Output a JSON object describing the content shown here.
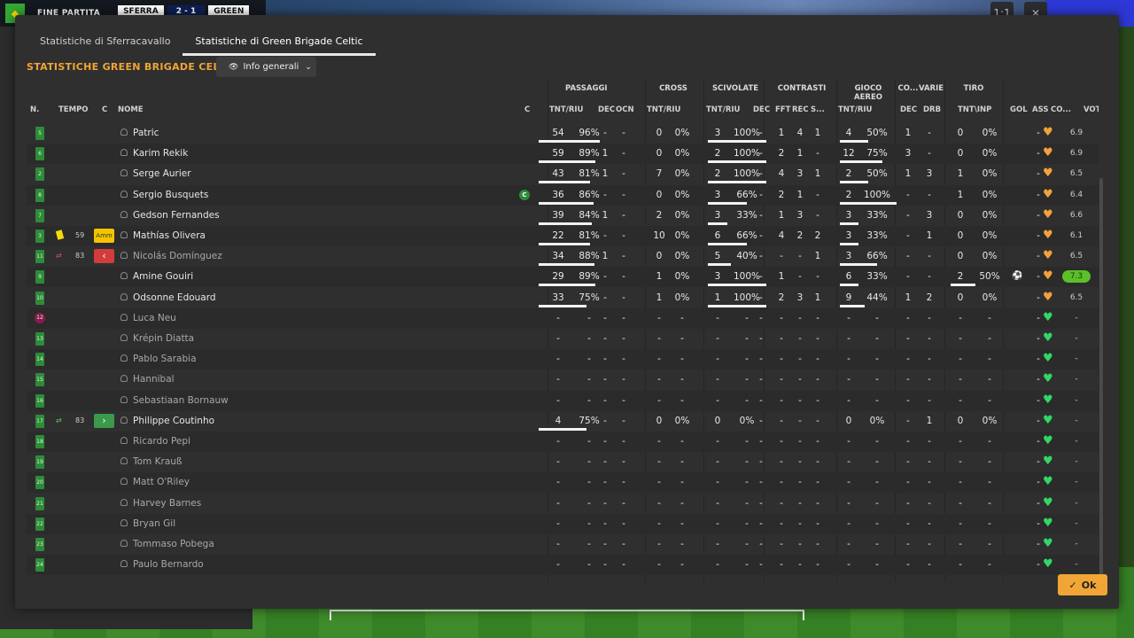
{
  "topbar": {
    "status": "FINE PARTITA",
    "team1": "SFERRA",
    "score": "2 - 1",
    "team2": "GREEN",
    "btn1": "1:1",
    "btn2": "✕"
  },
  "tabs": [
    {
      "label": "Statistiche di Sferracavallo"
    },
    {
      "label": "Statistiche di Green Brigade Celtic"
    }
  ],
  "heading": "STATISTICHE GREEN BRIGADE CELTIC",
  "dropdown": {
    "label": "Info generali"
  },
  "groups": {
    "passaggi": "PASSAGGI",
    "cross": "CROSS",
    "scivolate": "SCIVOLATE",
    "contrasti": "CONTRASTI",
    "aereo": "GIOCO AEREO",
    "co": "CO...",
    "varie": "VARIE",
    "tiro": "TIRO"
  },
  "columns": {
    "n": "N.",
    "tempo": "TEMPO",
    "c": "C",
    "nome": "NOME",
    "c2": "C",
    "pass": "TNT/RIU",
    "dec": "DEC",
    "ocn": "OCN",
    "cross": "TNT/RIU",
    "sciv": "TNT/RIU",
    "cdec": "DEC",
    "fft": "FFT",
    "rec": "REC",
    "s": "S...",
    "aereo": "TNT/RIU",
    "codec": "DEC",
    "drb": "DRB",
    "tiro": "TNT\\INP",
    "gol": "GOL",
    "ass": "ASS",
    "co2": "CO...",
    "vot": "VOT"
  },
  "players": [
    {
      "n": "5",
      "name": "Patric",
      "p1": "54",
      "p2": "96%",
      "dec": "-",
      "ocn": "-",
      "x1": "0",
      "x2": "0%",
      "s1": "3",
      "s2": "100%",
      "cd": "-",
      "fft": "1",
      "rec": "4",
      "s": "1",
      "a1": "4",
      "a2": "50%",
      "cod": "1",
      "drb": "-",
      "t1": "0",
      "t2": "0%",
      "gol": "",
      "ass": "-",
      "vot": "6.9",
      "pb": 0.96,
      "sb": 1.0,
      "ab": 0.5
    },
    {
      "n": "6",
      "name": "Karim Rekik",
      "p1": "59",
      "p2": "89%",
      "dec": "1",
      "ocn": "-",
      "x1": "0",
      "x2": "0%",
      "s1": "2",
      "s2": "100%",
      "cd": "-",
      "fft": "2",
      "rec": "1",
      "s": "-",
      "a1": "12",
      "a2": "75%",
      "cod": "3",
      "drb": "-",
      "t1": "0",
      "t2": "0%",
      "gol": "",
      "ass": "-",
      "vot": "6.9",
      "pb": 0.89,
      "sb": 1.0,
      "ab": 0.75
    },
    {
      "n": "2",
      "name": "Serge Aurier",
      "p1": "43",
      "p2": "81%",
      "dec": "1",
      "ocn": "-",
      "x1": "7",
      "x2": "0%",
      "s1": "2",
      "s2": "100%",
      "cd": "-",
      "fft": "4",
      "rec": "3",
      "s": "1",
      "a1": "2",
      "a2": "50%",
      "cod": "1",
      "drb": "3",
      "t1": "1",
      "t2": "0%",
      "gol": "",
      "ass": "-",
      "vot": "6.5",
      "pb": 0.81,
      "sb": 1.0,
      "ab": 0.5
    },
    {
      "n": "8",
      "name": "Sergio Busquets",
      "p1": "36",
      "p2": "86%",
      "dec": "-",
      "ocn": "-",
      "x1": "0",
      "x2": "0%",
      "s1": "3",
      "s2": "66%",
      "cd": "-",
      "fft": "2",
      "rec": "1",
      "s": "-",
      "a1": "2",
      "a2": "100%",
      "cod": "-",
      "drb": "-",
      "t1": "1",
      "t2": "0%",
      "gol": "",
      "ass": "-",
      "vot": "6.4",
      "pb": 0.86,
      "sb": 0.66,
      "ab": 1.0,
      "cap": "C"
    },
    {
      "n": "7",
      "name": "Gedson Fernandes",
      "p1": "39",
      "p2": "84%",
      "dec": "1",
      "ocn": "-",
      "x1": "2",
      "x2": "0%",
      "s1": "3",
      "s2": "33%",
      "cd": "-",
      "fft": "1",
      "rec": "3",
      "s": "-",
      "a1": "3",
      "a2": "33%",
      "cod": "-",
      "drb": "3",
      "t1": "0",
      "t2": "0%",
      "gol": "",
      "ass": "-",
      "vot": "6.6",
      "pb": 0.84,
      "sb": 0.33,
      "ab": 0.33
    },
    {
      "n": "3",
      "name": "Mathías Olivera",
      "tempo": "59",
      "card": "yellow",
      "amm": "Amm",
      "p1": "22",
      "p2": "81%",
      "dec": "-",
      "ocn": "-",
      "x1": "10",
      "x2": "0%",
      "s1": "6",
      "s2": "66%",
      "cd": "-",
      "fft": "4",
      "rec": "2",
      "s": "2",
      "a1": "3",
      "a2": "33%",
      "cod": "-",
      "drb": "1",
      "t1": "0",
      "t2": "0%",
      "gol": "",
      "ass": "-",
      "vot": "6.1",
      "pb": 0.81,
      "sb": 0.66,
      "ab": 0.33
    },
    {
      "n": "11",
      "name": "Nicolás Domínguez",
      "tempo": "83",
      "sub": "out",
      "dim": true,
      "p1": "34",
      "p2": "88%",
      "dec": "1",
      "ocn": "-",
      "x1": "0",
      "x2": "0%",
      "s1": "5",
      "s2": "40%",
      "cd": "-",
      "fft": "-",
      "rec": "-",
      "s": "1",
      "a1": "3",
      "a2": "66%",
      "cod": "-",
      "drb": "-",
      "t1": "0",
      "t2": "0%",
      "gol": "",
      "ass": "-",
      "vot": "6.5",
      "pb": 0.88,
      "sb": 0.4,
      "ab": 0.66
    },
    {
      "n": "9",
      "name": "Amine Gouiri",
      "p1": "29",
      "p2": "89%",
      "dec": "-",
      "ocn": "-",
      "x1": "1",
      "x2": "0%",
      "s1": "3",
      "s2": "100%",
      "cd": "-",
      "fft": "1",
      "rec": "-",
      "s": "-",
      "a1": "6",
      "a2": "33%",
      "cod": "-",
      "drb": "-",
      "t1": "2",
      "t2": "50%",
      "gol": "ball",
      "ass": "-",
      "vot": "7.3",
      "best": true,
      "pb": 0.89,
      "sb": 1.0,
      "ab": 0.33,
      "tb": 0.5
    },
    {
      "n": "10",
      "name": "Odsonne Edouard",
      "p1": "33",
      "p2": "75%",
      "dec": "-",
      "ocn": "-",
      "x1": "1",
      "x2": "0%",
      "s1": "1",
      "s2": "100%",
      "cd": "-",
      "fft": "2",
      "rec": "3",
      "s": "1",
      "a1": "9",
      "a2": "44%",
      "cod": "1",
      "drb": "2",
      "t1": "0",
      "t2": "0%",
      "gol": "",
      "ass": "-",
      "vot": "6.5",
      "pb": 0.75,
      "sb": 1.0,
      "ab": 0.44
    },
    {
      "n": "12",
      "name": "Luca Neu",
      "res": true,
      "empty": true
    },
    {
      "n": "13",
      "name": "Krépin Diatta",
      "empty": true
    },
    {
      "n": "14",
      "name": "Pablo Sarabia",
      "empty": true
    },
    {
      "n": "15",
      "name": "Hannibal",
      "empty": true
    },
    {
      "n": "16",
      "name": "Sebastiaan Bornauw",
      "empty": true
    },
    {
      "n": "17",
      "name": "Philippe Coutinho",
      "tempo": "83",
      "sub": "in",
      "p1": "4",
      "p2": "75%",
      "dec": "-",
      "ocn": "-",
      "x1": "0",
      "x2": "0%",
      "s1": "0",
      "s2": "0%",
      "cd": "-",
      "fft": "-",
      "rec": "-",
      "s": "-",
      "a1": "0",
      "a2": "0%",
      "cod": "-",
      "drb": "1",
      "t1": "0",
      "t2": "0%",
      "gol": "",
      "ass": "-",
      "vot": "-",
      "green": true,
      "pb": 0.75,
      "sb": 0,
      "ab": 0
    },
    {
      "n": "18",
      "name": "Ricardo Pepi",
      "empty": true
    },
    {
      "n": "19",
      "name": "Tom Krauß",
      "empty": true
    },
    {
      "n": "20",
      "name": "Matt O'Riley",
      "empty": true
    },
    {
      "n": "21",
      "name": "Harvey Barnes",
      "empty": true
    },
    {
      "n": "22",
      "name": "Bryan Gil",
      "empty": true
    },
    {
      "n": "23",
      "name": "Tommaso Pobega",
      "empty": true
    },
    {
      "n": "24",
      "name": "Paulo Bernardo",
      "empty": true
    }
  ],
  "ok_label": "Ok",
  "colors": {
    "accent": "#f0a536",
    "heart_orange": "#f2a23a",
    "heart_green": "#2fd867"
  }
}
